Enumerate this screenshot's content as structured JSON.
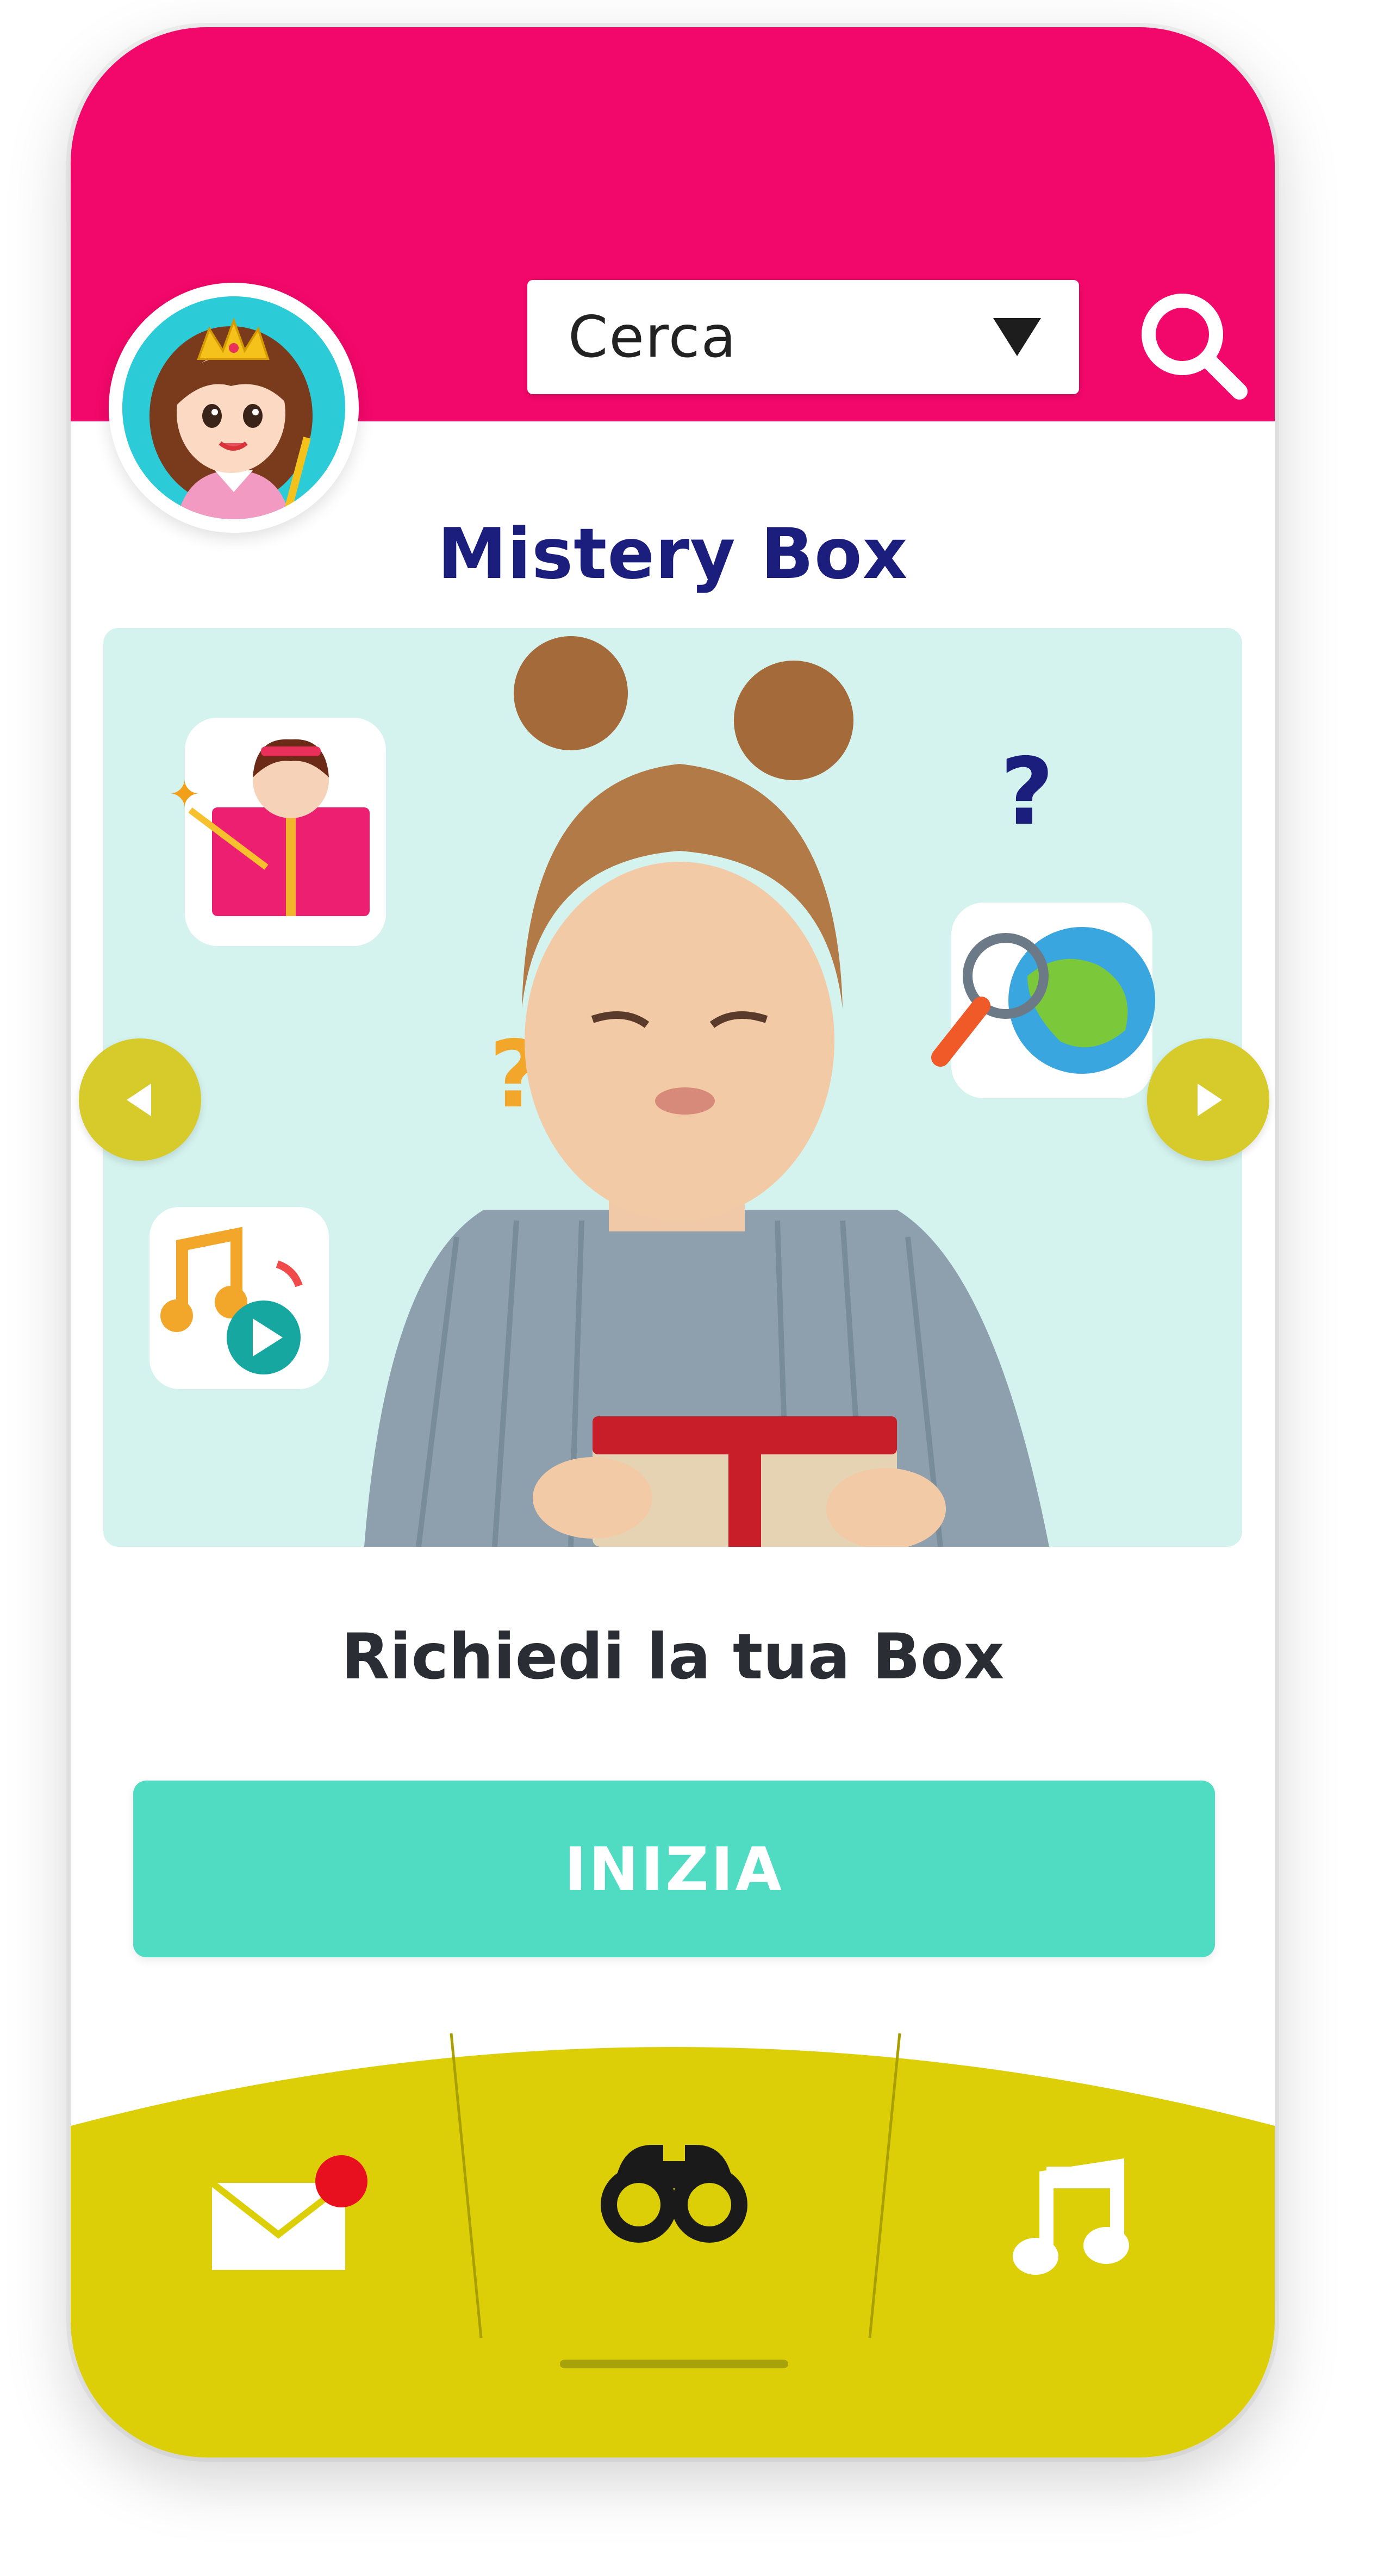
{
  "header": {
    "search": {
      "value": "Cerca"
    }
  },
  "page": {
    "title": "Mistery Box",
    "subtitle": "Richiedi la tua Box",
    "cta_label": "INIZIA"
  },
  "carousel": {
    "question_mark_1": "?",
    "question_mark_2": "?"
  },
  "bottom_nav": {
    "items": [
      {
        "icon": "mail-icon",
        "badge": true
      },
      {
        "icon": "binoculars-icon",
        "active": true
      },
      {
        "icon": "music-note-icon"
      }
    ]
  },
  "colors": {
    "header": "#f2086a",
    "title": "#1b1e7d",
    "hero_bg": "#d4f3ee",
    "cta": "#4fdcc2",
    "nav_bar": "#dccf08",
    "nav_btn": "#d7cb2b",
    "badge": "#e8101e"
  }
}
